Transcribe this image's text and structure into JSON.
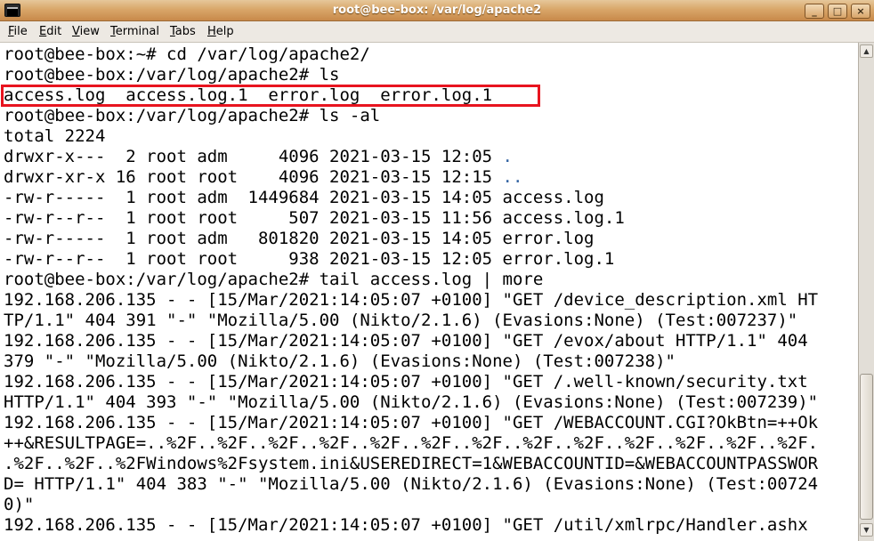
{
  "window": {
    "title": "root@bee-box: /var/log/apache2",
    "controls": {
      "minimize": "_",
      "maximize": "□",
      "close": "×"
    }
  },
  "menu": {
    "items": [
      "File",
      "Edit",
      "View",
      "Terminal",
      "Tabs",
      "Help"
    ]
  },
  "terminal": {
    "lines": [
      "root@bee-box:~# cd /var/log/apache2/",
      "root@bee-box:/var/log/apache2# ls",
      "access.log  access.log.1  error.log  error.log.1",
      "root@bee-box:/var/log/apache2# ls -al",
      "total 2224",
      "drwxr-x---  2 root adm     4096 2021-03-15 12:05 ",
      "drwxr-xr-x 16 root root    4096 2021-03-15 12:15 ",
      "-rw-r-----  1 root adm  1449684 2021-03-15 14:05 access.log",
      "-rw-r--r--  1 root root     507 2021-03-15 11:56 access.log.1",
      "-rw-r-----  1 root adm   801820 2021-03-15 14:05 error.log",
      "-rw-r--r--  1 root root     938 2021-03-15 12:05 error.log.1",
      "root@bee-box:/var/log/apache2# tail access.log | more",
      "192.168.206.135 - - [15/Mar/2021:14:05:07 +0100] \"GET /device_description.xml HT",
      "TP/1.1\" 404 391 \"-\" \"Mozilla/5.00 (Nikto/2.1.6) (Evasions:None) (Test:007237)\"",
      "192.168.206.135 - - [15/Mar/2021:14:05:07 +0100] \"GET /evox/about HTTP/1.1\" 404",
      "379 \"-\" \"Mozilla/5.00 (Nikto/2.1.6) (Evasions:None) (Test:007238)\"",
      "192.168.206.135 - - [15/Mar/2021:14:05:07 +0100] \"GET /.well-known/security.txt",
      "HTTP/1.1\" 404 393 \"-\" \"Mozilla/5.00 (Nikto/2.1.6) (Evasions:None) (Test:007239)\"",
      "192.168.206.135 - - [15/Mar/2021:14:05:07 +0100] \"GET /WEBACCOUNT.CGI?OkBtn=++Ok",
      "++&RESULTPAGE=..%2F..%2F..%2F..%2F..%2F..%2F..%2F..%2F..%2F..%2F..%2F..%2F..%2F.",
      ".%2F..%2F..%2FWindows%2Fsystem.ini&USEREDIRECT=1&WEBACCOUNTID=&WEBACCOUNTPASSWOR",
      "D= HTTP/1.1\" 404 383 \"-\" \"Mozilla/5.00 (Nikto/2.1.6) (Evasions:None) (Test:00724",
      "0)\"",
      "192.168.206.135 - - [15/Mar/2021:14:05:07 +0100] \"GET /util/xmlrpc/Handler.ashx"
    ],
    "dir_entries": {
      "current": ".",
      "parent": ".."
    }
  },
  "colors": {
    "titlebar": "#d9a76a",
    "highlight_box": "#e8141f",
    "directory_link": "#3465a4",
    "terminal_bg": "#ffffff",
    "terminal_fg": "#000000"
  }
}
